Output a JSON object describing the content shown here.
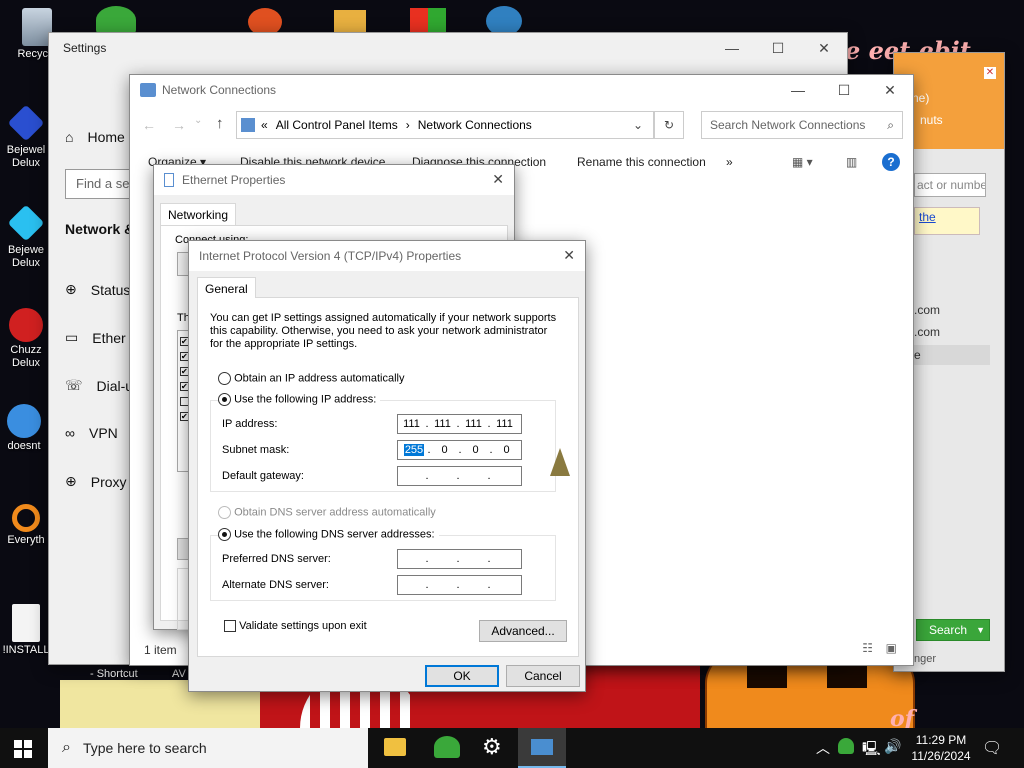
{
  "desktop": {
    "icons": [
      {
        "label": "Recycle"
      },
      {
        "label": "Bejewel Delux"
      },
      {
        "label": "Bejewe Delux"
      },
      {
        "label": "Chuzz Delux"
      },
      {
        "label": "doesnt"
      },
      {
        "label": "Everyth"
      },
      {
        "label": "!INSTALL"
      }
    ],
    "shortcut_label": "- Shortcut",
    "av_label": "AV",
    "bg_text_top": "e eet ebit",
    "bg_text_bottom": "of"
  },
  "settings": {
    "title": "Settings",
    "home": "Home",
    "find_placeholder": "Find a se",
    "section": "Network &",
    "nav": [
      {
        "label": "Status"
      },
      {
        "label": "Ether"
      },
      {
        "label": "Dial-u"
      },
      {
        "label": "VPN"
      },
      {
        "label": "Proxy"
      }
    ]
  },
  "right_window": {
    "line1": "ne)",
    "line2": "nuts",
    "search_placeholder": "act or numbe",
    "link_text": "the",
    "list": [
      ".com",
      ".com",
      "e"
    ],
    "search_button": "Search",
    "footer": "nger"
  },
  "netconn": {
    "title": "Network Connections",
    "breadcrumb_prefix": "«",
    "breadcrumb": [
      "All Control Panel Items",
      "Network Connections"
    ],
    "search_placeholder": "Search Network Connections",
    "commands": [
      "Organize ▾",
      "Disable this network device",
      "Diagnose this connection",
      "Rename this connection",
      "»"
    ],
    "status": "1 item"
  },
  "ethernet": {
    "title": "Ethernet Properties",
    "tab": "Networking",
    "connect_using": "Connect using:",
    "this_conn": "Th",
    "desc": "D"
  },
  "ipv4": {
    "title": "Internet Protocol Version 4 (TCP/IPv4) Properties",
    "tab": "General",
    "intro": "You can get IP settings assigned automatically if your network supports this capability. Otherwise, you need to ask your network administrator for the appropriate IP settings.",
    "obtain_auto": "Obtain an IP address automatically",
    "use_following": "Use the following IP address:",
    "ip_label": "IP address:",
    "ip_value": [
      "111",
      "111",
      "111",
      "111"
    ],
    "subnet_label": "Subnet mask:",
    "subnet_value": [
      "255",
      "0",
      "0",
      "0"
    ],
    "gateway_label": "Default gateway:",
    "dns_auto": "Obtain DNS server address automatically",
    "dns_use": "Use the following DNS server addresses:",
    "preferred_label": "Preferred DNS server:",
    "alternate_label": "Alternate DNS server:",
    "validate": "Validate settings upon exit",
    "advanced": "Advanced...",
    "ok": "OK",
    "cancel": "Cancel"
  },
  "taskbar": {
    "search_placeholder": "Type here to search",
    "time": "11:29 PM",
    "date": "11/26/2024"
  },
  "colors": {
    "accent": "#0078d7",
    "selection": "#0078d7",
    "taskbar": "#101010",
    "search_button": "#3aa63a"
  }
}
